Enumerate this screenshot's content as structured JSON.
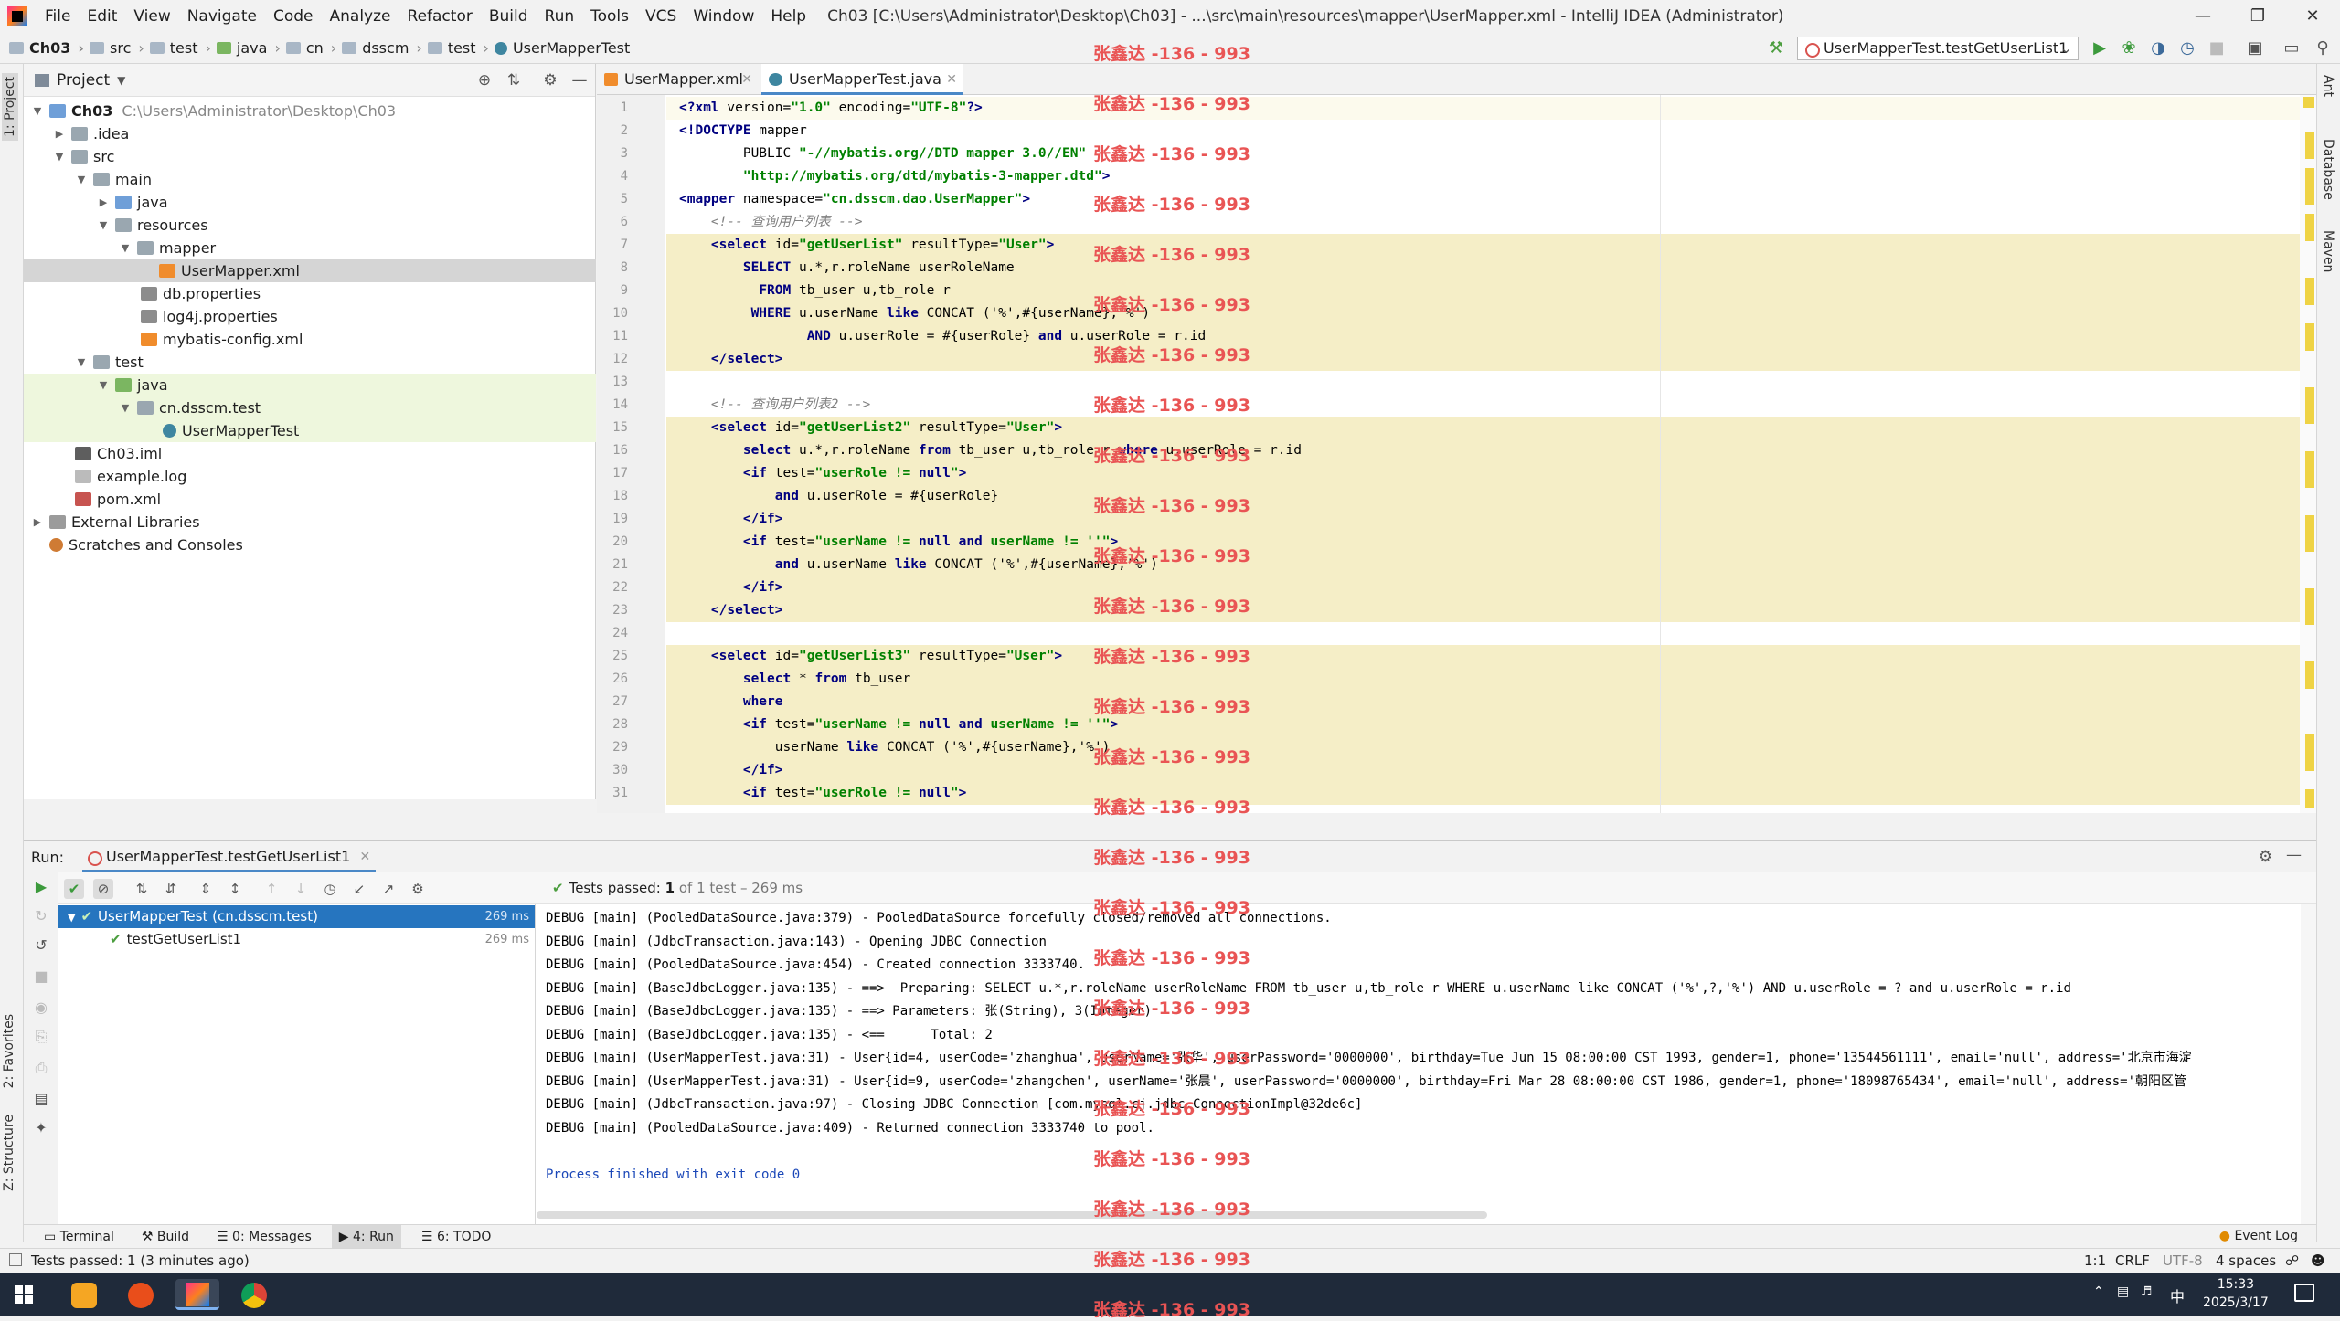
{
  "menubar": {
    "items": [
      "File",
      "Edit",
      "View",
      "Navigate",
      "Code",
      "Analyze",
      "Refactor",
      "Build",
      "Run",
      "Tools",
      "VCS",
      "Window",
      "Help"
    ],
    "title": "Ch03 [C:\\Users\\Administrator\\Desktop\\Ch03] - ...\\src\\main\\resources\\mapper\\UserMapper.xml - IntelliJ IDEA (Administrator)"
  },
  "breadcrumb": [
    "Ch03",
    "src",
    "test",
    "java",
    "cn",
    "dsscm",
    "test",
    "UserMapperTest"
  ],
  "run_config": "UserMapperTest.testGetUserList1",
  "side": {
    "project": "1: Project",
    "favorites": "2: Favorites",
    "structure": "Z: Structure",
    "ant": "Ant",
    "database": "Database",
    "maven": "Maven"
  },
  "project": {
    "title": "Project",
    "root_name": "Ch03",
    "root_path": "C:\\Users\\Administrator\\Desktop\\Ch03",
    "nodes": [
      ".idea",
      "src",
      "main",
      "java",
      "resources",
      "mapper",
      "UserMapper.xml",
      "db.properties",
      "log4j.properties",
      "mybatis-config.xml",
      "test",
      "java",
      "cn.dsscm.test",
      "UserMapperTest",
      "Ch03.iml",
      "example.log",
      "pom.xml",
      "External Libraries",
      "Scratches and Consoles"
    ]
  },
  "tabs": [
    "UserMapper.xml",
    "UserMapperTest.java"
  ],
  "code_lines": [
    "<?xml version=\"1.0\" encoding=\"UTF-8\"?>",
    "<!DOCTYPE mapper",
    "        PUBLIC \"-//mybatis.org//DTD mapper 3.0//EN\"",
    "        \"http://mybatis.org/dtd/mybatis-3-mapper.dtd\">",
    "<mapper namespace=\"cn.dsscm.dao.UserMapper\">",
    "    <!-- 查询用户列表 -->",
    "    <select id=\"getUserList\" resultType=\"User\">",
    "        SELECT u.*,r.roleName userRoleName",
    "          FROM tb_user u,tb_role r",
    "         WHERE u.userName like CONCAT ('%',#{userName},'%')",
    "                AND u.userRole = #{userRole} and u.userRole = r.id",
    "    </select>",
    "",
    "    <!-- 查询用户列表2 -->",
    "    <select id=\"getUserList2\" resultType=\"User\">",
    "        select u.*,r.roleName from tb_user u,tb_role r where u.userRole = r.id",
    "        <if test=\"userRole != null\">",
    "            and u.userRole = #{userRole}",
    "        </if>",
    "        <if test=\"userName != null and userName != ''\">",
    "            and u.userName like CONCAT ('%',#{userName},'%')",
    "        </if>",
    "    </select>",
    "",
    "    <select id=\"getUserList3\" resultType=\"User\">",
    "        select * from tb_user",
    "        where",
    "        <if test=\"userName != null and userName != ''\">",
    "            userName like CONCAT ('%',#{userName},'%')",
    "        </if>",
    "        <if test=\"userRole != null\">"
  ],
  "run": {
    "label": "Run:",
    "tab": "UserMapperTest.testGetUserList1",
    "status_prefix": "Tests passed:",
    "status_count": "1",
    "status_rest": "of 1 test – 269 ms",
    "tree": [
      {
        "name": "UserMapperTest (cn.dsscm.test)",
        "ms": "269 ms"
      },
      {
        "name": "testGetUserList1",
        "ms": "269 ms"
      }
    ],
    "console": [
      "DEBUG [main] (PooledDataSource.java:379) - PooledDataSource forcefully closed/removed all connections.",
      "DEBUG [main] (JdbcTransaction.java:143) - Opening JDBC Connection",
      "DEBUG [main] (PooledDataSource.java:454) - Created connection 3333740.",
      "DEBUG [main] (BaseJdbcLogger.java:135) - ==>  Preparing: SELECT u.*,r.roleName userRoleName FROM tb_user u,tb_role r WHERE u.userName like CONCAT ('%',?,'%') AND u.userRole = ? and u.userRole = r.id",
      "DEBUG [main] (BaseJdbcLogger.java:135) - ==> Parameters: 张(String), 3(Integer)",
      "DEBUG [main] (BaseJdbcLogger.java:135) - <==      Total: 2",
      "DEBUG [main] (UserMapperTest.java:31) - User{id=4, userCode='zhanghua', userName='张华', userPassword='0000000', birthday=Tue Jun 15 08:00:00 CST 1993, gender=1, phone='13544561111', email='null', address='北京市海淀",
      "DEBUG [main] (UserMapperTest.java:31) - User{id=9, userCode='zhangchen', userName='张晨', userPassword='0000000', birthday=Fri Mar 28 08:00:00 CST 1986, gender=1, phone='18098765434', email='null', address='朝阳区管",
      "DEBUG [main] (JdbcTransaction.java:97) - Closing JDBC Connection [com.mysql.cj.jdbc.ConnectionImpl@32de6c]",
      "DEBUG [main] (PooledDataSource.java:409) - Returned connection 3333740 to pool.",
      "",
      "Process finished with exit code 0"
    ]
  },
  "bottom_tabs": [
    "Terminal",
    "Build",
    "0: Messages",
    "4: Run",
    "6: TODO"
  ],
  "event_log": "Event Log",
  "status": {
    "left": "Tests passed: 1 (3 minutes ago)",
    "pos": "1:1",
    "eol": "CRLF",
    "enc": "UTF-8",
    "indent": "4 spaces"
  },
  "taskbar": {
    "time": "15:33",
    "date": "2025/3/17",
    "ime": "中"
  },
  "watermark": "张鑫达 -136 - 993"
}
